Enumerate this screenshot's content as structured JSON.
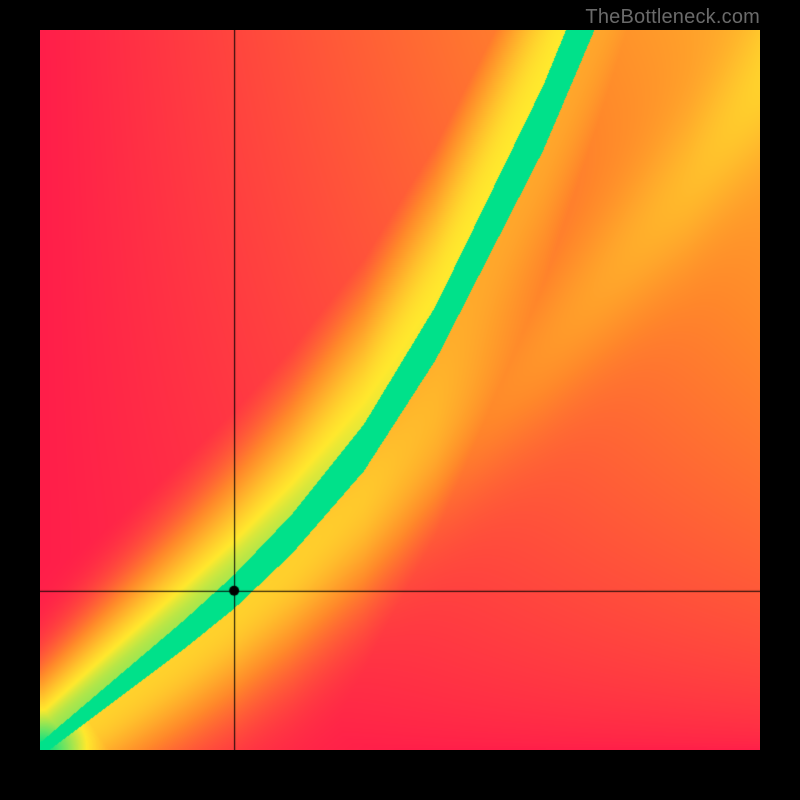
{
  "watermark": "TheBottleneck.com",
  "chart_data": {
    "type": "heatmap",
    "title": "",
    "xlabel": "",
    "ylabel": "",
    "xlim": [
      0,
      100
    ],
    "ylim": [
      0,
      100
    ],
    "crosshair": {
      "x": 27,
      "y": 22
    },
    "marker": {
      "x": 27,
      "y": 22,
      "radius": 5,
      "color": "#000000"
    },
    "ridge": {
      "comment": "Approximate centerline of the green optimal band (x -> y).",
      "points": [
        {
          "x": 0,
          "y": 0
        },
        {
          "x": 10,
          "y": 8
        },
        {
          "x": 20,
          "y": 16
        },
        {
          "x": 27,
          "y": 22
        },
        {
          "x": 35,
          "y": 30
        },
        {
          "x": 45,
          "y": 42
        },
        {
          "x": 55,
          "y": 58
        },
        {
          "x": 62,
          "y": 72
        },
        {
          "x": 70,
          "y": 88
        },
        {
          "x": 75,
          "y": 100
        }
      ],
      "green_halfwidth_base": 1.0,
      "green_halfwidth_scale": 0.05,
      "yellow_halo_extra": 4.0
    },
    "secondary_ridge": {
      "comment": "Faint yellow secondary line below the main band.",
      "points": [
        {
          "x": 30,
          "y": 20
        },
        {
          "x": 50,
          "y": 35
        },
        {
          "x": 70,
          "y": 55
        },
        {
          "x": 90,
          "y": 78
        },
        {
          "x": 100,
          "y": 92
        }
      ],
      "influence": 0.15
    },
    "colors": {
      "red": "#ff1e4a",
      "orange": "#ff8a2a",
      "yellow": "#ffe92e",
      "green": "#00e18a"
    }
  },
  "layout": {
    "outer_size": 800,
    "plot_size": 720,
    "plot_offset": {
      "left": 40,
      "top": 30
    }
  }
}
